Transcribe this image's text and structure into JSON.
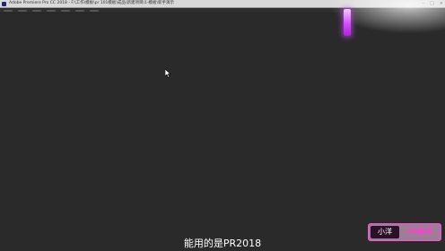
{
  "window": {
    "title": "Adobe Premiere Pro CC 2018 - F:\\工作\\模板\\pr 101模板\\成品\\新建项目\\1-模板\\新手演示"
  },
  "overlay": {
    "subtitle": "能用的是PR2018",
    "watermark_left": "小洋",
    "watermark_right": "PR教学"
  },
  "colors": {
    "workspace_bg": "#2a2a2a",
    "accent_glow": "#d34dff",
    "watermark_border": "#ff4fd8"
  },
  "icons": {
    "cursor": "mouse-pointer-icon",
    "app": "premiere-pro-icon"
  }
}
